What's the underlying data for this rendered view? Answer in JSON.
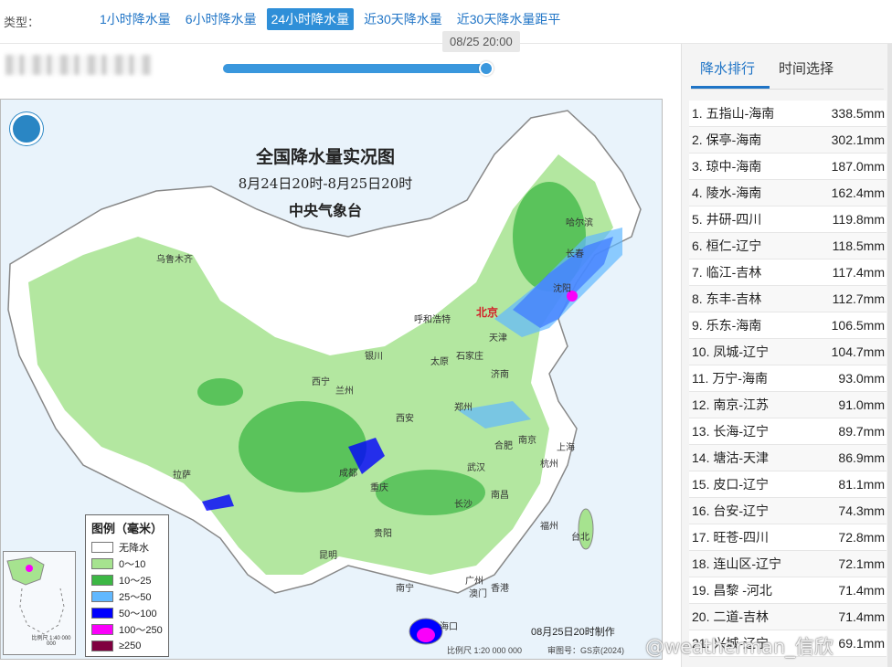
{
  "filter": {
    "label": "类型：",
    "tabs": [
      {
        "label": "1小时降水量",
        "active": false
      },
      {
        "label": "6小时降水量",
        "active": false
      },
      {
        "label": "24小时降水量",
        "active": true
      },
      {
        "label": "近30天降水量",
        "active": false
      },
      {
        "label": "近30天降水量距平",
        "active": false
      }
    ]
  },
  "timeline": {
    "tooltip": "08/25 20:00",
    "progress": 1.0
  },
  "map": {
    "title": "全国降水量实况图",
    "period": "8月24日20时-8月25日20时",
    "issuer": "中央气象台",
    "footer": "08月25日20时制作",
    "scale": "比例尺 1:20 000 000",
    "review": "审图号：GS京(2024)",
    "inset_caption": "比例尺 1:40 000 000",
    "cities": [
      {
        "name": "乌鲁木齐"
      },
      {
        "name": "哈尔滨"
      },
      {
        "name": "长春"
      },
      {
        "name": "沈阳"
      },
      {
        "name": "北京"
      },
      {
        "name": "呼和浩特"
      },
      {
        "name": "天津"
      },
      {
        "name": "银川"
      },
      {
        "name": "太原"
      },
      {
        "name": "石家庄"
      },
      {
        "name": "济南"
      },
      {
        "name": "西宁"
      },
      {
        "name": "兰州"
      },
      {
        "name": "郑州"
      },
      {
        "name": "西安"
      },
      {
        "name": "合肥"
      },
      {
        "name": "南京"
      },
      {
        "name": "上海"
      },
      {
        "name": "杭州"
      },
      {
        "name": "武汉"
      },
      {
        "name": "成都"
      },
      {
        "name": "重庆"
      },
      {
        "name": "拉萨"
      },
      {
        "name": "长沙"
      },
      {
        "name": "南昌"
      },
      {
        "name": "福州"
      },
      {
        "name": "台北"
      },
      {
        "name": "贵阳"
      },
      {
        "name": "昆明"
      },
      {
        "name": "南宁"
      },
      {
        "name": "广州"
      },
      {
        "name": "香港"
      },
      {
        "name": "澳门"
      },
      {
        "name": "海口"
      }
    ],
    "legend": {
      "title": "图例（毫米）",
      "items": [
        {
          "label": "无降水",
          "color": "#ffffff"
        },
        {
          "label": "0～10",
          "color": "#a6e38f"
        },
        {
          "label": "10～25",
          "color": "#3cb744"
        },
        {
          "label": "25～50",
          "color": "#61b8ff"
        },
        {
          "label": "50～100",
          "color": "#0000fe"
        },
        {
          "label": "100～250",
          "color": "#fa00fa"
        },
        {
          "label": "≥250",
          "color": "#800040"
        }
      ]
    }
  },
  "sidepanel": {
    "tabs": [
      {
        "label": "降水排行",
        "active": true
      },
      {
        "label": "时间选择",
        "active": false
      }
    ],
    "ranking": [
      {
        "name": "1. 五指山-海南",
        "value": "338.5mm"
      },
      {
        "name": "2. 保亭-海南",
        "value": "302.1mm"
      },
      {
        "name": "3. 琼中-海南",
        "value": "187.0mm"
      },
      {
        "name": "4. 陵水-海南",
        "value": "162.4mm"
      },
      {
        "name": "5. 井研-四川",
        "value": "119.8mm"
      },
      {
        "name": "6. 桓仁-辽宁",
        "value": "118.5mm"
      },
      {
        "name": "7. 临江-吉林",
        "value": "117.4mm"
      },
      {
        "name": "8. 东丰-吉林",
        "value": "112.7mm"
      },
      {
        "name": "9. 乐东-海南",
        "value": "106.5mm"
      },
      {
        "name": "10. 凤城-辽宁",
        "value": "104.7mm"
      },
      {
        "name": "11. 万宁-海南",
        "value": "93.0mm"
      },
      {
        "name": "12. 南京-江苏",
        "value": "91.0mm"
      },
      {
        "name": "13. 长海-辽宁",
        "value": "89.7mm"
      },
      {
        "name": "14. 塘沽-天津",
        "value": "86.9mm"
      },
      {
        "name": "15. 皮口-辽宁",
        "value": "81.1mm"
      },
      {
        "name": "16. 台安-辽宁",
        "value": "74.3mm"
      },
      {
        "name": "17. 旺苍-四川",
        "value": "72.8mm"
      },
      {
        "name": "18. 连山区-辽宁",
        "value": "72.1mm"
      },
      {
        "name": "19. 昌黎 -河北",
        "value": "71.4mm"
      },
      {
        "name": "20. 二道-吉林",
        "value": "71.4mm"
      },
      {
        "name": "21. 兴城-辽宁",
        "value": "69.1mm"
      }
    ]
  },
  "watermark": "@weatherman_信欣"
}
